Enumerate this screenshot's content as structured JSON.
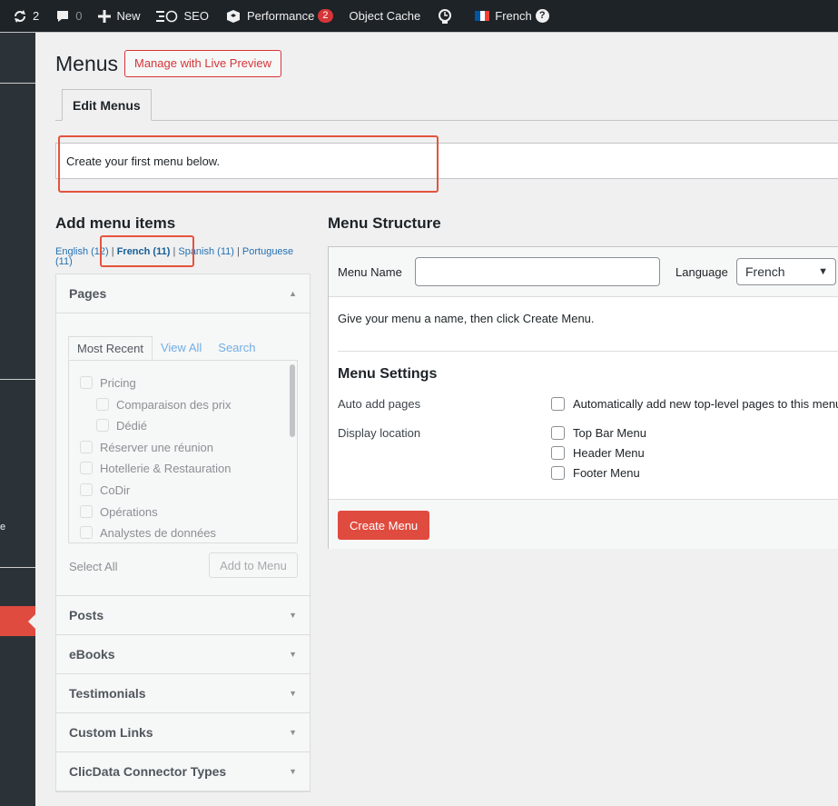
{
  "admin_bar": {
    "updates_count": "2",
    "comments_count": "0",
    "new_label": "New",
    "seo_label": "SEO",
    "performance_label": "Performance",
    "performance_badge": "2",
    "object_cache_label": "Object Cache",
    "language_label": "French",
    "help_glyph": "?"
  },
  "admin_menu": {
    "fragment_text": "e"
  },
  "header": {
    "title": "Menus",
    "live_preview_label": "Manage with Live Preview"
  },
  "tabs": [
    {
      "label": "Edit Menus",
      "active": true
    }
  ],
  "notice": {
    "text": "Create your first menu below."
  },
  "add_items": {
    "title": "Add menu items",
    "languages": [
      {
        "label": "English (12)"
      },
      {
        "label": "French (11)",
        "current": true
      },
      {
        "label": "Spanish (11)"
      },
      {
        "label": "Portuguese (11)"
      }
    ],
    "separator": "|",
    "pages": {
      "title": "Pages",
      "tabs": [
        "Most Recent",
        "View All",
        "Search"
      ],
      "items": [
        {
          "label": "Pricing",
          "level": 0
        },
        {
          "label": "Comparaison des prix",
          "level": 1
        },
        {
          "label": "Dédié",
          "level": 1
        },
        {
          "label": "Réserver une réunion",
          "level": 0
        },
        {
          "label": "Hotellerie & Restauration",
          "level": 0
        },
        {
          "label": "CoDir",
          "level": 0
        },
        {
          "label": "Opérations",
          "level": 0
        },
        {
          "label": "Analystes de données",
          "level": 0
        }
      ],
      "select_all": "Select All",
      "add_button": "Add to Menu"
    },
    "sections": [
      "Posts",
      "eBooks",
      "Testimonials",
      "Custom Links",
      "ClicData Connector Types"
    ]
  },
  "structure": {
    "title": "Menu Structure",
    "menu_name_label": "Menu Name",
    "menu_name_value": "",
    "language_label": "Language",
    "language_value": "French",
    "instructions": "Give your menu a name, then click Create Menu.",
    "settings_title": "Menu Settings",
    "auto_add_label": "Auto add pages",
    "auto_add_option": "Automatically add new top-level pages to this menu",
    "display_location_label": "Display location",
    "locations": [
      "Top Bar Menu",
      "Header Menu",
      "Footer Menu"
    ],
    "create_button": "Create Menu"
  },
  "colors": {
    "admin_bar": "#1d2327",
    "admin_menu": "#2c3338",
    "accent": "#e04b3f",
    "link": "#2271b1",
    "annotation_box": "#e5533d"
  }
}
